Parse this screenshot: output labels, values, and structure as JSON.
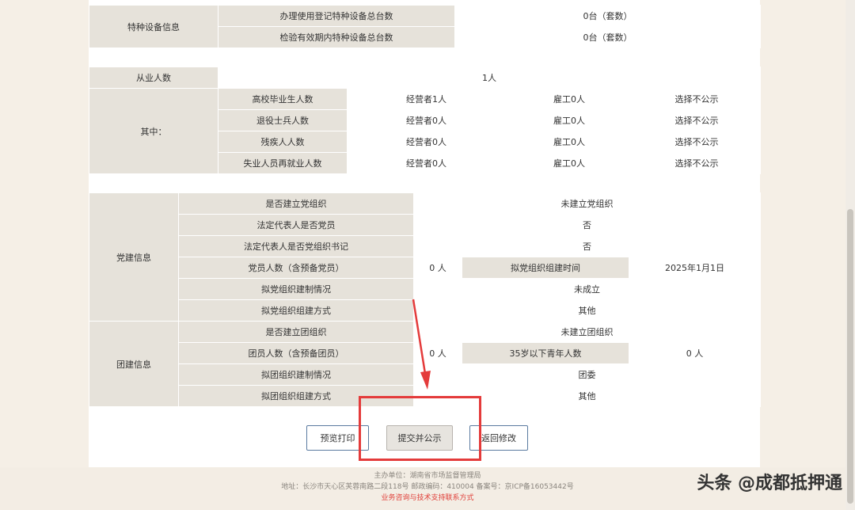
{
  "equipment": {
    "section_label": "特种设备信息",
    "rows": [
      {
        "label": "办理使用登记特种设备总台数",
        "value": "0台（套数）"
      },
      {
        "label": "检验有效期内特种设备总台数",
        "value": "0台（套数）"
      }
    ]
  },
  "employees": {
    "total_label": "从业人数",
    "total_value": "1人",
    "among_label": "其中：",
    "rows": [
      {
        "label": "高校毕业生人数",
        "operator": "经营者1人",
        "hired": "雇工0人",
        "disclosure": "选择不公示"
      },
      {
        "label": "退役士兵人数",
        "operator": "经营者0人",
        "hired": "雇工0人",
        "disclosure": "选择不公示"
      },
      {
        "label": "残疾人人数",
        "operator": "经营者0人",
        "hired": "雇工0人",
        "disclosure": "选择不公示"
      },
      {
        "label": "失业人员再就业人数",
        "operator": "经营者0人",
        "hired": "雇工0人",
        "disclosure": "选择不公示"
      }
    ]
  },
  "party": {
    "section_label": "党建信息",
    "established_label": "是否建立党组织",
    "established_value": "未建立党组织",
    "rep_member_label": "法定代表人是否党员",
    "rep_member_value": "否",
    "rep_secretary_label": "法定代表人是否党组织书记",
    "rep_secretary_value": "否",
    "members_label": "党员人数（含预备党员）",
    "members_value": "0 人",
    "planned_time_label": "拟党组织组建时间",
    "planned_time_value": "2025年1月1日",
    "planned_status_label": "拟党组织建制情况",
    "planned_status_value": "未成立",
    "planned_method_label": "拟党组织组建方式",
    "planned_method_value": "其他"
  },
  "league": {
    "section_label": "团建信息",
    "established_label": "是否建立团组织",
    "established_value": "未建立团组织",
    "members_label": "团员人数（含预备团员）",
    "members_value": "0 人",
    "youth_label": "35岁以下青年人数",
    "youth_value": "0 人",
    "planned_status_label": "拟团组织建制情况",
    "planned_status_value": "团委",
    "planned_method_label": "拟团组织组建方式",
    "planned_method_value": "其他"
  },
  "buttons": {
    "preview_print": "预览打印",
    "submit_publish": "提交并公示",
    "return_edit": "返回修改"
  },
  "footer": {
    "organizer": "主办单位：湖南省市场监督管理局",
    "address": "地址：长沙市天心区芙蓉南路二段118号 邮政编码：410004 备案号：京ICP备16053442号",
    "support": "业务咨询与技术支持联系方式"
  },
  "watermark": "头条 @成都抵押通",
  "colors": {
    "highlight": "#e43b3b",
    "label_bg": "#e6e2da",
    "page_bg": "#f5efe6"
  }
}
